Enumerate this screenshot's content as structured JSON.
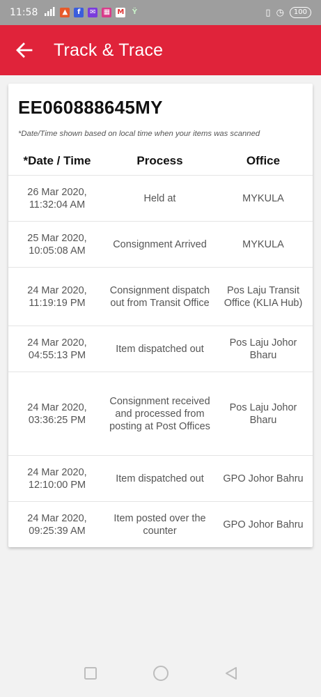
{
  "status_bar": {
    "time": "11:58",
    "battery": "100",
    "icons": [
      "signal-icon",
      "app-icon",
      "facebook-icon",
      "email-icon",
      "grid-app-icon",
      "gmail-icon",
      "wechat-icon",
      "vibrate-icon",
      "alarm-icon",
      "battery-icon"
    ]
  },
  "app_bar": {
    "title": "Track & Trace",
    "back_icon": "arrow-left-icon",
    "color": "#e0233a"
  },
  "tracking": {
    "number": "EE060888645MY",
    "note": "*Date/Time shown based on local time when your items was scanned"
  },
  "table": {
    "headers": [
      "*Date / Time",
      "Process",
      "Office"
    ],
    "rows": [
      {
        "date": "26 Mar 2020,",
        "time": "11:32:04 AM",
        "process": "Held at",
        "office": "MYKULA"
      },
      {
        "date": "25 Mar 2020,",
        "time": "10:05:08 AM",
        "process": "Consignment Arrived",
        "office": "MYKULA"
      },
      {
        "date": "24 Mar 2020,",
        "time": "11:19:19 PM",
        "process": "Consignment dispatch out from Transit Office",
        "office": "Pos Laju Transit Office (KLIA Hub)"
      },
      {
        "date": "24 Mar 2020,",
        "time": "04:55:13 PM",
        "process": "Item dispatched out",
        "office": "Pos Laju Johor Bharu"
      },
      {
        "date": "24 Mar 2020,",
        "time": "03:36:25 PM",
        "process": "Consignment received and processed from posting at Post Offices",
        "office": "Pos Laju Johor Bharu"
      },
      {
        "date": "24 Mar 2020,",
        "time": "12:10:00 PM",
        "process": "Item dispatched out",
        "office": "GPO Johor Bahru"
      },
      {
        "date": "24 Mar 2020,",
        "time": "09:25:39 AM",
        "process": "Item posted over the counter",
        "office": "GPO Johor Bahru"
      }
    ]
  },
  "nav_bar": {
    "icons": [
      "recent-apps-icon",
      "home-icon",
      "back-icon"
    ]
  }
}
